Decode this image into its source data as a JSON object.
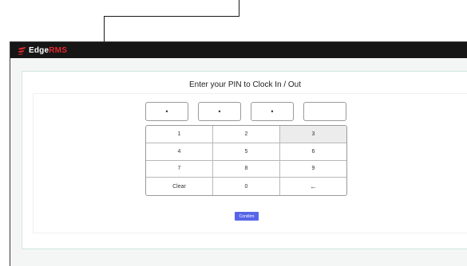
{
  "app": {
    "logo_edge": "Edge",
    "logo_rms": "RMS"
  },
  "page": {
    "title": "Enter your PIN to Clock In / Out"
  },
  "pin": {
    "digits": [
      "•",
      "•",
      "•",
      ""
    ]
  },
  "keypad": {
    "keys": [
      "1",
      "2",
      "3",
      "4",
      "5",
      "6",
      "7",
      "8",
      "9",
      "Clear",
      "0",
      "←"
    ]
  },
  "actions": {
    "confirm_label": "Condirm"
  },
  "colors": {
    "topbar": "#161616",
    "brand_red": "#e0282e",
    "button_blue": "#5865e8",
    "card_border": "#cfe6de"
  }
}
